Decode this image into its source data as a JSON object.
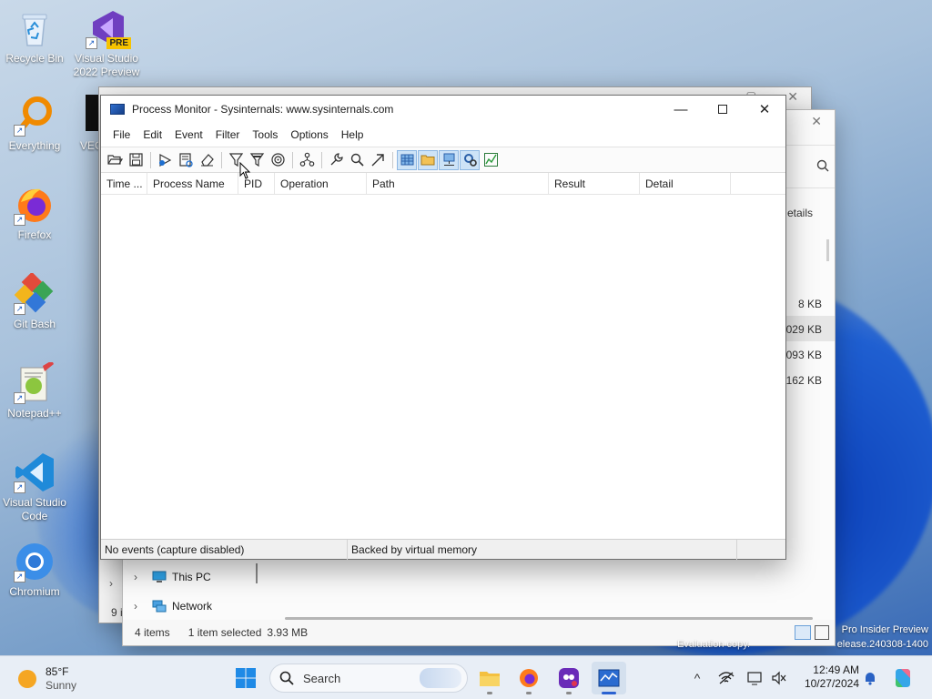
{
  "desktop": {
    "icons": [
      {
        "label": "Recycle Bin"
      },
      {
        "label": "Visual Studio 2022 Preview",
        "badge": "PRE"
      },
      {
        "label": "Everything"
      },
      {
        "label": "VEC"
      },
      {
        "label": "Firefox"
      },
      {
        "label": "Git Bash"
      },
      {
        "label": "Notepad++"
      },
      {
        "label": "Visual Studio Code"
      },
      {
        "label": "Chromium"
      }
    ],
    "watermark": {
      "line1": "Pro Insider Preview",
      "line2": "Evaluation copy.",
      "line3": "elease.240308-1400"
    }
  },
  "explorer": {
    "details_label": "etails",
    "sizes": [
      "8 KB",
      ",029 KB",
      ",093 KB",
      ",162 KB"
    ],
    "nav": [
      {
        "label": "This PC"
      },
      {
        "label": "Network"
      }
    ],
    "count_left": "9 i",
    "status": {
      "items": "4 items",
      "selected": "1 item selected",
      "size": "3.93 MB"
    }
  },
  "procmon": {
    "title": "Process Monitor - Sysinternals: www.sysinternals.com",
    "menu": [
      "File",
      "Edit",
      "Event",
      "Filter",
      "Tools",
      "Options",
      "Help"
    ],
    "columns": [
      "Time ...",
      "Process Name",
      "PID",
      "Operation",
      "Path",
      "Result",
      "Detail"
    ],
    "status": {
      "events": "No events (capture disabled)",
      "memory": "Backed by virtual memory"
    }
  },
  "taskbar": {
    "weather": {
      "temp": "85°F",
      "condition": "Sunny"
    },
    "search_placeholder": "Search",
    "clock": {
      "time": "12:49 AM",
      "date": "10/27/2024"
    }
  },
  "colors": {
    "accent": "#2b62d1",
    "titlebar": "#ffffff",
    "status_bg": "#f0f0f0"
  }
}
